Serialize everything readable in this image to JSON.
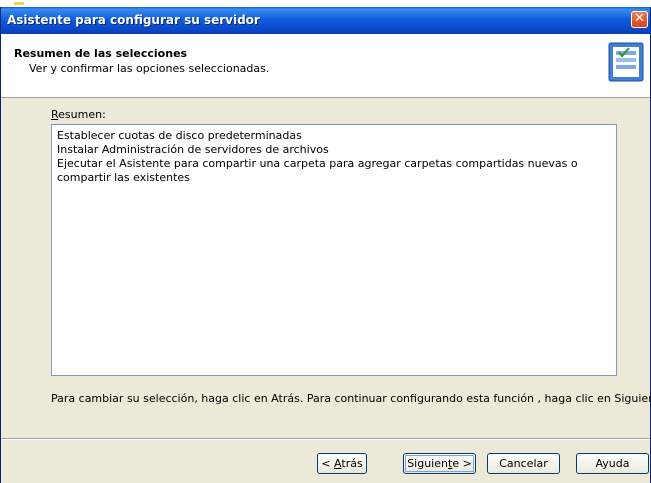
{
  "window": {
    "title": "Asistente para configurar su servidor",
    "close_label": "✕"
  },
  "header": {
    "title": "Resumen de las selecciones",
    "subtitle": "Ver y confirmar las opciones seleccionadas."
  },
  "summary": {
    "label_first": "R",
    "label_rest": "esumen:",
    "lines": [
      "Establecer cuotas de disco predeterminadas",
      "Instalar Administración de servidores de archivos",
      "Ejecutar el Asistente para compartir una carpeta para agregar carpetas compartidas nuevas o compartir las existentes"
    ]
  },
  "hint": "Para cambiar su selección, haga clic en Atrás. Para continuar configurando esta función , haga clic en Siguiente.",
  "buttons": {
    "back_prefix": "< ",
    "back_mnemonic": "A",
    "back_rest": "trás",
    "next_prefix": "Siguien",
    "next_mnemonic": "t",
    "next_rest": "e >",
    "cancel": "Cancelar",
    "help": "Ayuda"
  },
  "colors": {
    "titlebar": "#0a5fd8",
    "dialog_bg": "#ece9d8",
    "close_button": "#d8421a"
  },
  "icons": {
    "header_icon": "server-wizard-icon",
    "close": "close-icon"
  }
}
